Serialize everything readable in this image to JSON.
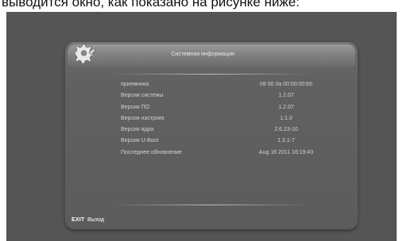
{
  "caption": "выводится окно, как показано на рисунке ниже:",
  "window": {
    "title": "Системная информация"
  },
  "info_rows": [
    {
      "label": "приемника",
      "value": "09 00 0a 00:00:00:b5"
    },
    {
      "label": "Версия системы",
      "value": "1.2.07"
    },
    {
      "label": "Версия ПО",
      "value": "1.2.07"
    },
    {
      "label": "Версия настроек",
      "value": "1.1.0"
    },
    {
      "label": "Версия ядра",
      "value": "2.6.23-10"
    },
    {
      "label": "Версия U-Boot",
      "value": "1.3.1-7"
    },
    {
      "label": "Последнее обновление",
      "value": "Aug 16 2011 16:19:43"
    }
  ],
  "footer": {
    "exit_key": "EXIT",
    "exit_label": "Выход"
  }
}
